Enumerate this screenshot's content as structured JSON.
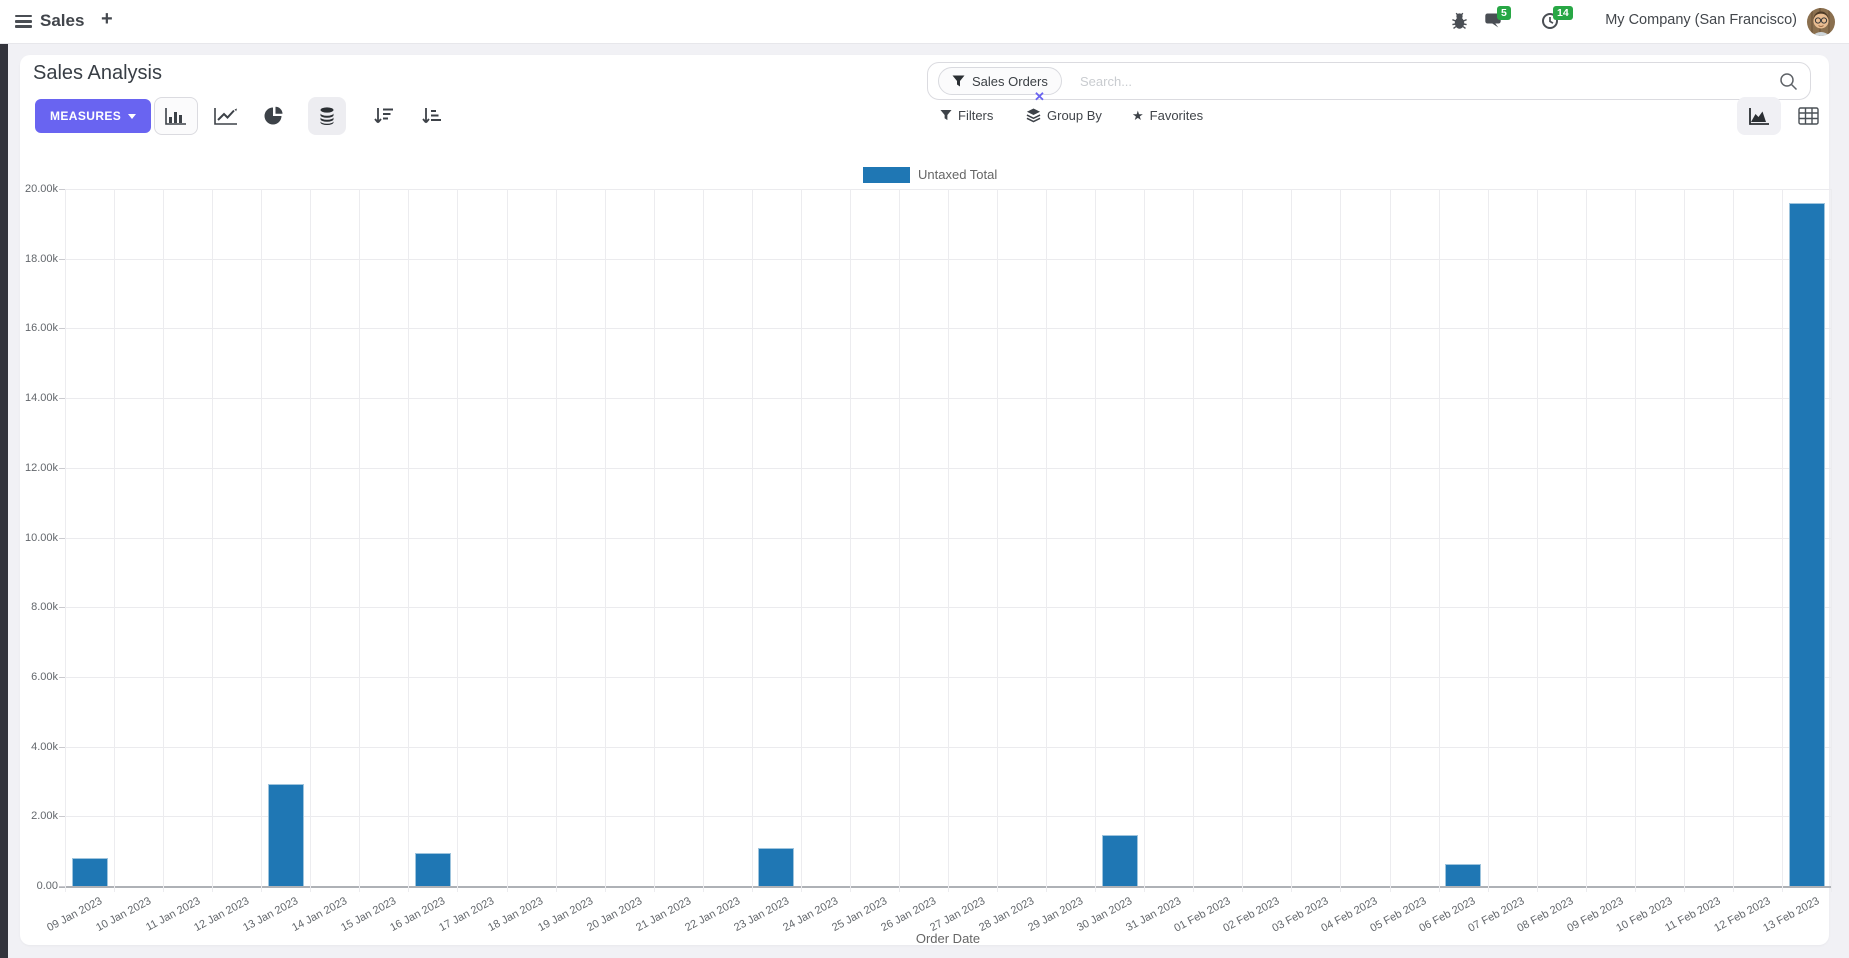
{
  "colors": {
    "primary": "#6964f1",
    "bar": "#1f77b4",
    "badge": "#28a745"
  },
  "icons": [
    "hamburger-icon",
    "plus-icon",
    "bug-icon",
    "chat-icon",
    "clock-icon",
    "avatar",
    "caret-down-icon",
    "bar-chart-icon",
    "line-chart-icon",
    "pie-chart-icon",
    "stacked-icon",
    "sort-desc-icon",
    "sort-asc-icon",
    "filter-icon",
    "layers-icon",
    "star-icon",
    "search-icon",
    "area-chart-icon",
    "pivot-icon",
    "close-icon"
  ],
  "navbar": {
    "app_name": "Sales",
    "new_label": "+",
    "message_count": "5",
    "activity_count": "14",
    "company": "My Company (San Francisco)"
  },
  "control_panel": {
    "title": "Sales Analysis",
    "measures_label": "MEASURES",
    "search": {
      "facet_label": "Sales Orders",
      "facet_remove": "✕",
      "placeholder": "Search..."
    },
    "filters_label": "Filters",
    "group_by_label": "Group By",
    "favorites_label": "Favorites"
  },
  "chart_data": {
    "type": "bar",
    "title": "",
    "xlabel": "Order Date",
    "ylabel": "",
    "ylim": [
      0,
      20000
    ],
    "grid": true,
    "legend_position": "top",
    "y_tick_labels": [
      "0.00",
      "2.00k",
      "4.00k",
      "6.00k",
      "8.00k",
      "10.00k",
      "12.00k",
      "14.00k",
      "16.00k",
      "18.00k",
      "20.00k"
    ],
    "categories": [
      "09 Jan 2023",
      "10 Jan 2023",
      "11 Jan 2023",
      "12 Jan 2023",
      "13 Jan 2023",
      "14 Jan 2023",
      "15 Jan 2023",
      "16 Jan 2023",
      "17 Jan 2023",
      "18 Jan 2023",
      "19 Jan 2023",
      "20 Jan 2023",
      "21 Jan 2023",
      "22 Jan 2023",
      "23 Jan 2023",
      "24 Jan 2023",
      "25 Jan 2023",
      "26 Jan 2023",
      "27 Jan 2023",
      "28 Jan 2023",
      "29 Jan 2023",
      "30 Jan 2023",
      "31 Jan 2023",
      "01 Feb 2023",
      "02 Feb 2023",
      "03 Feb 2023",
      "04 Feb 2023",
      "05 Feb 2023",
      "06 Feb 2023",
      "07 Feb 2023",
      "08 Feb 2023",
      "09 Feb 2023",
      "10 Feb 2023",
      "11 Feb 2023",
      "12 Feb 2023",
      "13 Feb 2023"
    ],
    "series": [
      {
        "name": "Untaxed Total",
        "color": "#1f77b4",
        "values": [
          800,
          0,
          0,
          0,
          2930,
          0,
          0,
          960,
          0,
          0,
          0,
          0,
          0,
          0,
          1100,
          0,
          0,
          0,
          0,
          0,
          0,
          1470,
          0,
          0,
          0,
          0,
          0,
          0,
          630,
          0,
          0,
          0,
          0,
          0,
          0,
          19600
        ]
      }
    ]
  }
}
